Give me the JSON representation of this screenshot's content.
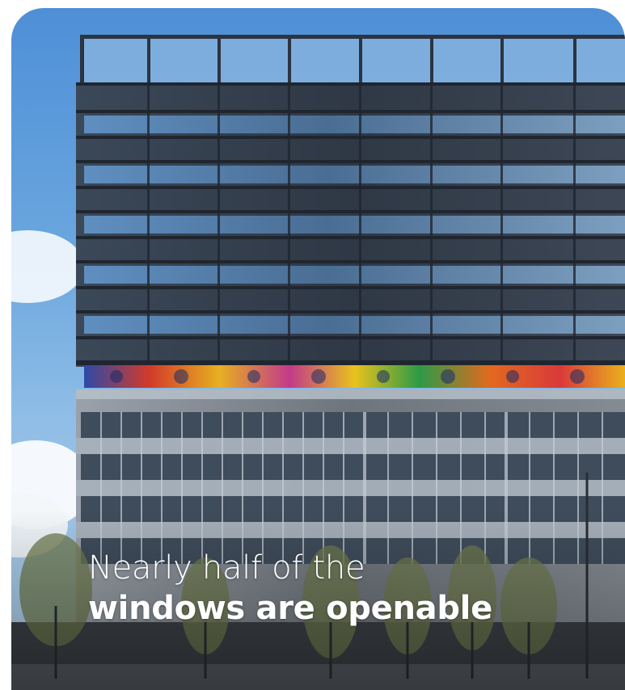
{
  "caption": {
    "line1": "Nearly half of the",
    "line2": "windows are openable"
  },
  "colors": {
    "sky": "#6aa6df",
    "upper_facade": "#3a4352",
    "lower_facade": "#8c9199",
    "mural": "#d9a21e"
  }
}
